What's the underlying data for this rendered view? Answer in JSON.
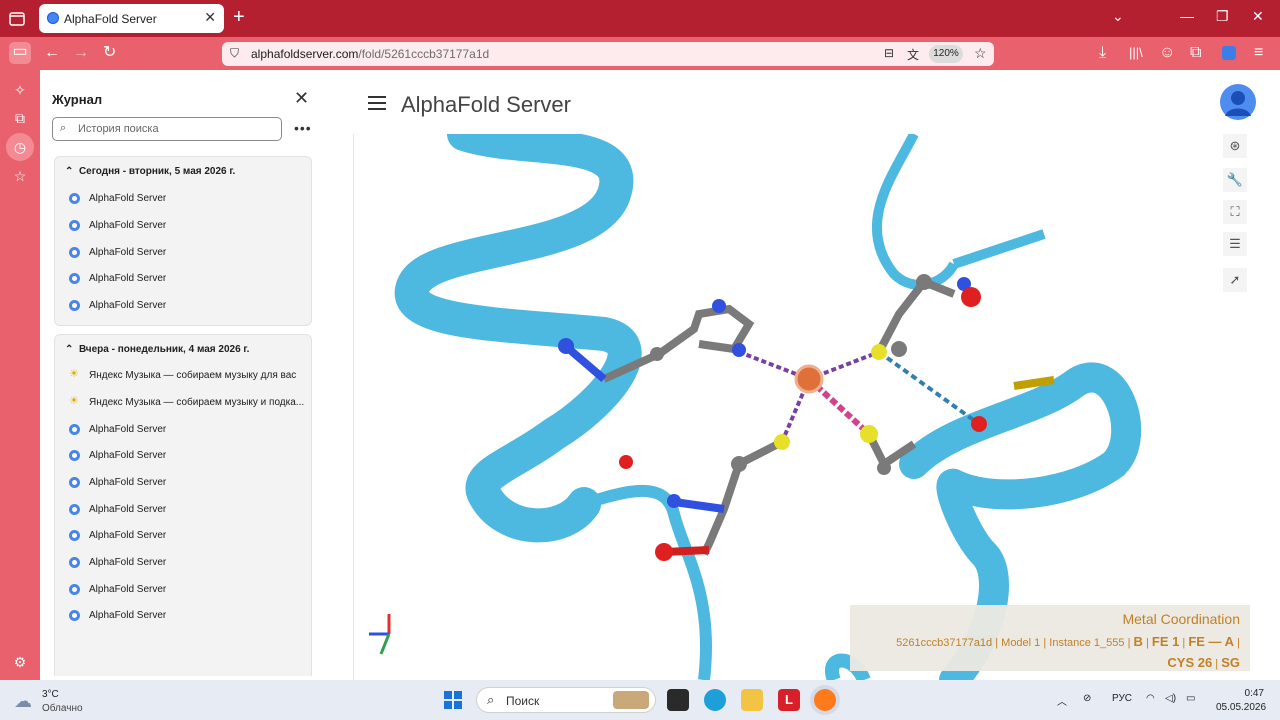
{
  "browser": {
    "tab_title": "AlphaFold Server",
    "url_host": "alphafoldserver.com",
    "url_path": "/fold/5261cccb37177a1d",
    "zoom": "120%"
  },
  "history": {
    "title": "Журнал",
    "search_placeholder": "История поиска",
    "groups": [
      {
        "header": "Сегодня - вторник, 5 мая 2026 г.",
        "items": [
          "AlphaFold Server",
          "AlphaFold Server",
          "AlphaFold Server",
          "AlphaFold Server",
          "AlphaFold Server"
        ]
      },
      {
        "header": "Вчера - понедельник, 4 мая 2026 г.",
        "items": [
          "Яндекс Музыка — собираем музыку для вас",
          "Яндекс Музыка — собираем музыку и подка...",
          "AlphaFold Server",
          "AlphaFold Server",
          "AlphaFold Server",
          "AlphaFold Server",
          "AlphaFold Server",
          "AlphaFold Server",
          "AlphaFold Server",
          "AlphaFold Server"
        ]
      }
    ]
  },
  "app": {
    "title": "AlphaFold Server"
  },
  "info_panel": {
    "title": "Metal Coordination",
    "id": "5261cccb37177a1d",
    "model": "Model 1",
    "instance": "Instance 1_555",
    "chain": "B",
    "residue": "FE 1",
    "comp": "FE — A",
    "target": "CYS 26",
    "atom": "SG"
  },
  "taskbar": {
    "temp": "3°C",
    "condition": "Облачно",
    "search_label": "Поиск",
    "lang": "РУС",
    "time": "0:47",
    "date": "05.05.2026"
  },
  "colors": {
    "titlebar": "#b4202f",
    "navbar": "#e9616d",
    "ribbon": "#4db8e0",
    "info_text": "#c07a1a"
  }
}
